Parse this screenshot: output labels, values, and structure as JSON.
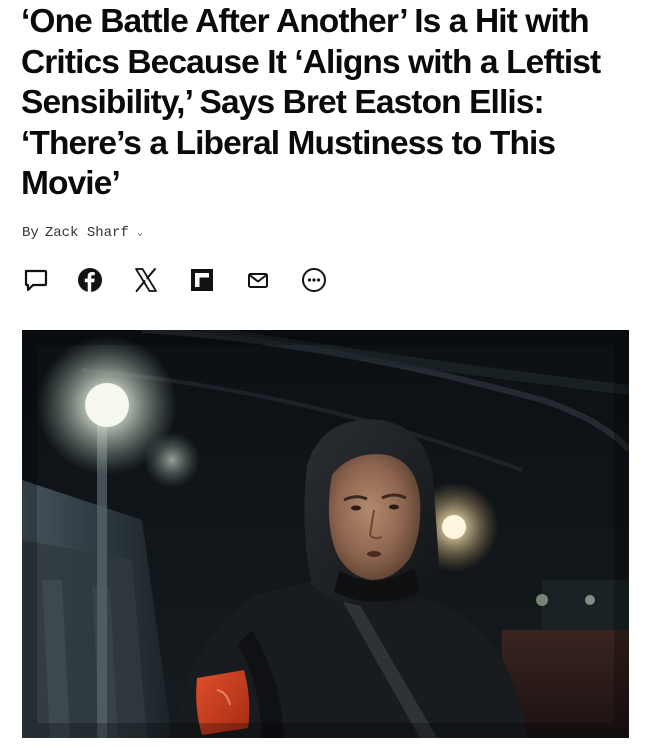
{
  "article": {
    "headline": "‘One Battle After Another’ Is a Hit with Critics Because It ‘Aligns with a Leftist Sensibility,’ Says Bret Easton Ellis: ‘There’s a Liberal Mustiness to This Movie’",
    "byline_prefix": "By",
    "author": "Zack Sharf"
  },
  "share": {
    "buttons": [
      {
        "icon": "comment-icon"
      },
      {
        "icon": "facebook-icon"
      },
      {
        "icon": "x-icon"
      },
      {
        "icon": "flipboard-icon"
      },
      {
        "icon": "email-icon"
      },
      {
        "icon": "more-icon"
      }
    ]
  },
  "hero_image": {
    "subject": "hooded man in black jacket with red armband at night",
    "colors": {
      "background": "#0b0d10",
      "armband": "#c63a1e",
      "light": "#f2f6e8"
    }
  }
}
